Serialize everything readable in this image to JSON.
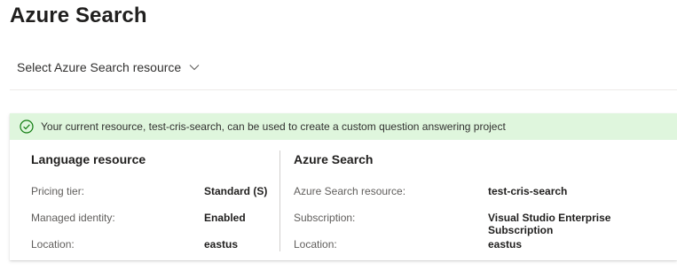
{
  "page": {
    "title": "Azure Search"
  },
  "selector": {
    "label": "Select Azure Search resource"
  },
  "banner": {
    "message": "Your current resource, test-cris-search, can be used to create a custom question answering project",
    "status_color": "#dff6dd",
    "icon": "check-circle-icon"
  },
  "language_resource": {
    "title": "Language resource",
    "rows": [
      {
        "label": "Pricing tier:",
        "value": "Standard (S)"
      },
      {
        "label": "Managed identity:",
        "value": "Enabled"
      },
      {
        "label": "Location:",
        "value": "eastus"
      }
    ]
  },
  "azure_search": {
    "title": "Azure Search",
    "rows": [
      {
        "label": "Azure Search resource:",
        "value": "test-cris-search"
      },
      {
        "label": "Subscription:",
        "value": "Visual Studio Enterprise Subscription"
      },
      {
        "label": "Location:",
        "value": "eastus"
      }
    ]
  }
}
